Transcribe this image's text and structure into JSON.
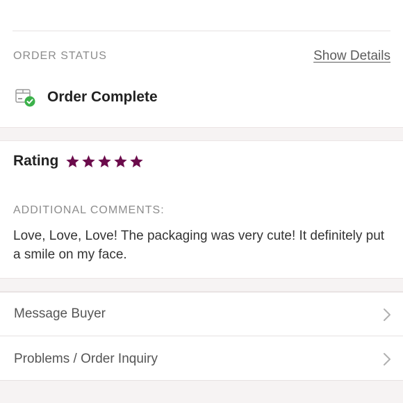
{
  "order_status": {
    "label": "ORDER STATUS",
    "show_details": "Show Details",
    "status_text": "Order Complete",
    "status_icon": "package-check-icon"
  },
  "rating": {
    "label": "Rating",
    "stars": 5,
    "max_stars": 5,
    "star_color": "#6b0b4b"
  },
  "comments": {
    "label": "ADDITIONAL COMMENTS:",
    "text": "Love, Love, Love! The packaging was very cute! It definitely put a smile on my face."
  },
  "menu": {
    "items": [
      {
        "label": "Message Buyer",
        "icon": "chevron-right-icon"
      },
      {
        "label": "Problems / Order Inquiry",
        "icon": "chevron-right-icon"
      }
    ]
  },
  "colors": {
    "accent_star": "#6b0b4b",
    "success_green": "#3bb14a",
    "muted_label": "#8c8c8c"
  }
}
